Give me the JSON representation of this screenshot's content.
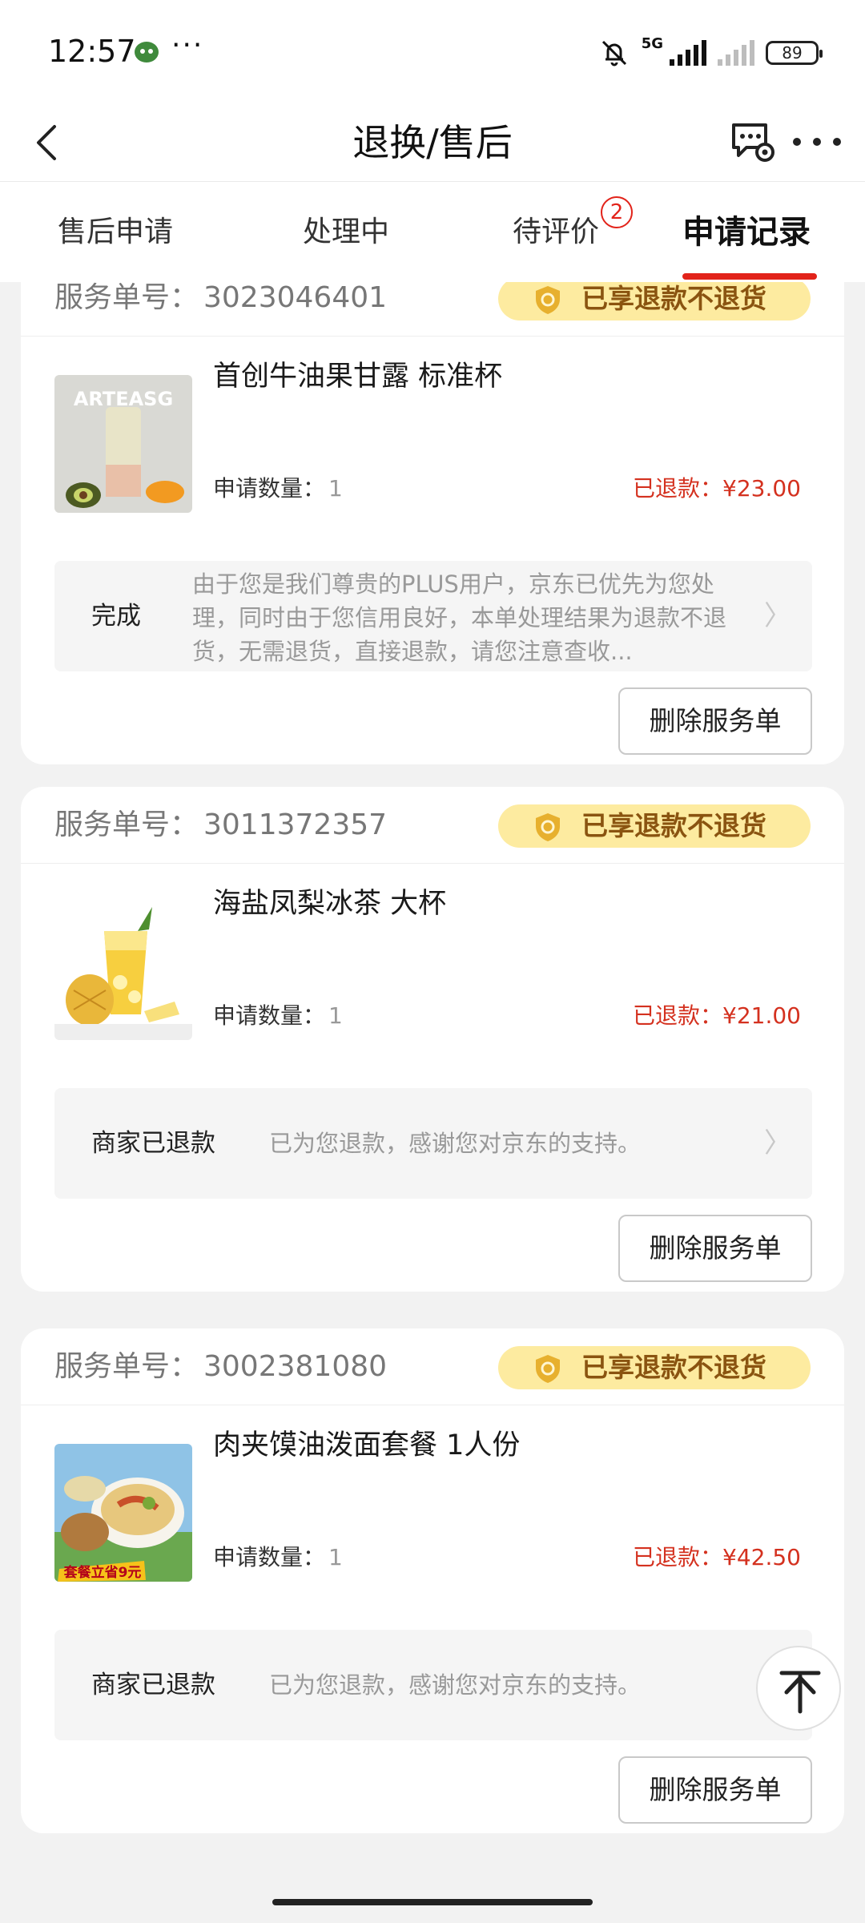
{
  "status_bar": {
    "time": "12:57",
    "more": "···",
    "network": "5G",
    "battery": "89"
  },
  "nav": {
    "title": "退换/售后",
    "back_icon": "chevron-left-icon",
    "service_icon": "customer-service-chat-icon",
    "more_icon": "more-dots-icon"
  },
  "tabs": [
    {
      "label": "售后申请"
    },
    {
      "label": "处理中"
    },
    {
      "label": "待评价",
      "badge": "2"
    },
    {
      "label": "申请记录",
      "active": true
    }
  ],
  "labels": {
    "service_no": "服务单号：",
    "quantity": "申请数量：",
    "perk": "已享退款不退货",
    "delete": "删除服务单"
  },
  "orders": [
    {
      "service_number": "3023046401",
      "product_name": "首创牛油果甘露 标准杯",
      "thumb_text": "ARTEASG",
      "quantity": "1",
      "refund": "已退款：¥23.00",
      "status": "完成",
      "status_desc": "由于您是我们尊贵的PLUS用户，京东已优先为您处理，同时由于您信用良好，本单处理结果为退款不退货，无需退货，直接退款，请您注意查收..."
    },
    {
      "service_number": "3011372357",
      "product_name": "海盐凤梨冰茶 大杯",
      "quantity": "1",
      "refund": "已退款：¥21.00",
      "status": "商家已退款",
      "status_desc": "已为您退款，感谢您对京东的支持。"
    },
    {
      "service_number": "3002381080",
      "product_name": "肉夹馍油泼面套餐 1人份",
      "thumb_text": "套餐立省9元",
      "quantity": "1",
      "refund": "已退款：¥42.50",
      "status": "商家已退款",
      "status_desc": "已为您退款，感谢您对京东的支持。"
    }
  ],
  "colors": {
    "accent_red": "#e2231a",
    "refund_red": "#d4311f",
    "perk_bg": "#fdeba0",
    "perk_text": "#8a5410"
  }
}
